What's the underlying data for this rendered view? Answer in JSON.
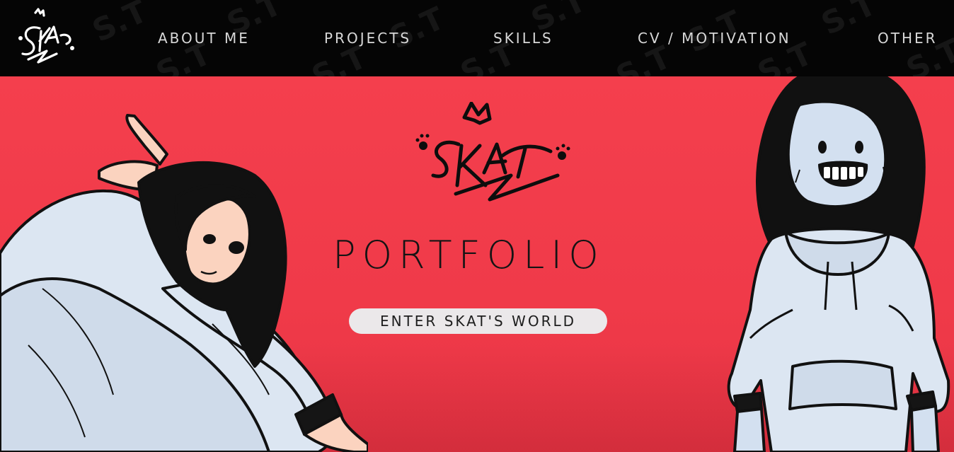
{
  "nav": {
    "logo_text": "SKAT",
    "items": [
      {
        "label": "ABOUT ME"
      },
      {
        "label": "PROJECTS"
      },
      {
        "label": "SKILLS"
      },
      {
        "label": "CV / MOTIVATION"
      },
      {
        "label": "OTHER"
      }
    ],
    "pattern_text": "SKAT"
  },
  "hero": {
    "logo_text": "SKAT",
    "title": "PORTFOLIO",
    "cta_label": "ENTER SKAT'S WORLD"
  },
  "colors": {
    "nav_background": "#050505",
    "hero_background": "#f23e4c",
    "nav_text": "#d8d8d8",
    "title_text": "#141414",
    "button_background": "#ebe8ea",
    "hoodie": "#dce6f2",
    "hair": "#111111",
    "skin": "#fbd3bf"
  },
  "icons": {
    "nav_logo": "skat-graffiti-logo-icon",
    "hero_logo": "skat-graffiti-crown-logo-icon",
    "left_illustration": "girl-in-hoodie-illustration",
    "right_illustration": "smiling-girl-in-hoodie-illustration"
  }
}
